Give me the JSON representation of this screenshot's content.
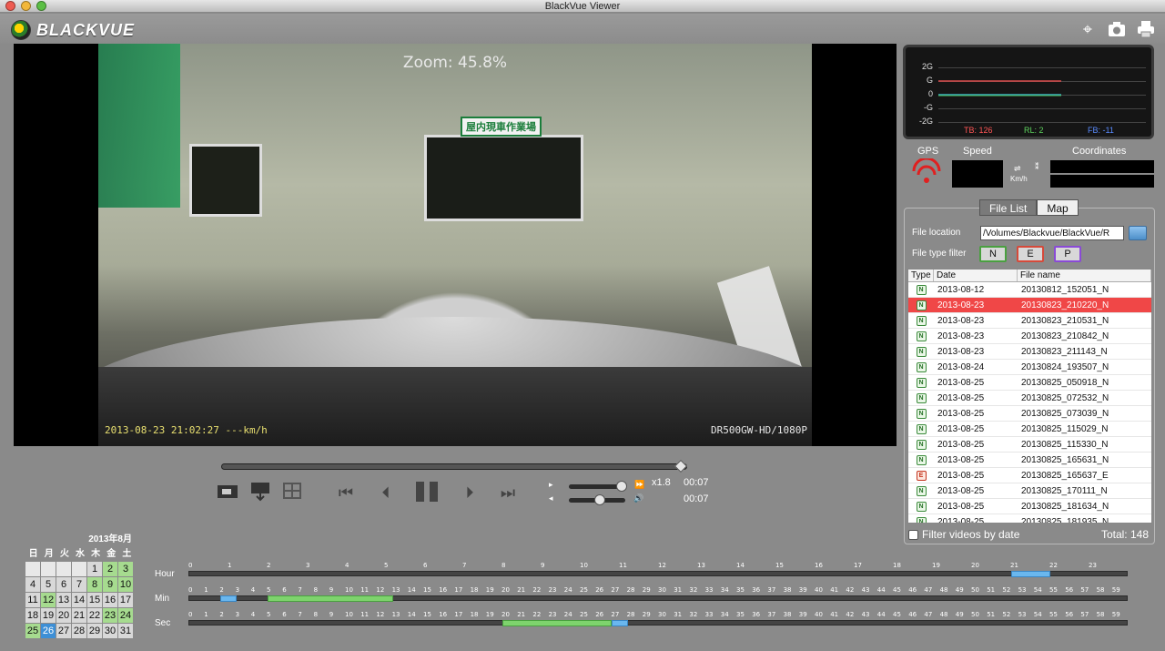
{
  "window": {
    "title": "BlackVue Viewer"
  },
  "brand": {
    "name": "BLACKVUE"
  },
  "toolbar_icons": [
    "crosshair-icon",
    "camera-icon",
    "printer-icon"
  ],
  "video": {
    "zoom_text": "Zoom: 45.8%",
    "timestamp": "2013-08-23 21:02:27  ---km/h",
    "model": "DR500GW-HD/1080P",
    "sign_text": "屋内現車作業場"
  },
  "playback": {
    "progress": 0.99,
    "speed_label": "x1.8",
    "time_top": "00:07",
    "time_bottom": "00:07"
  },
  "gsensor": {
    "labels": [
      "2G",
      "G",
      "0",
      "-G",
      "-2G"
    ],
    "tb": "TB: 126",
    "rl": "RL: 2",
    "fb": "FB: -11"
  },
  "gps": {
    "gps_label": "GPS",
    "speed_label": "Speed",
    "unit": "Km/h",
    "coords_label": "Coordinates"
  },
  "tabs": {
    "file_list": "File List",
    "map": "Map"
  },
  "filelist": {
    "location_label": "File location",
    "location_value": "/Volumes/Blackvue/BlackVue/R",
    "filter_label": "File type filter",
    "filters": [
      "N",
      "E",
      "P"
    ],
    "columns": [
      "Type",
      "Date",
      "File name"
    ],
    "rows": [
      {
        "type": "N",
        "date": "2013-08-12",
        "file": "20130812_152051_N"
      },
      {
        "type": "N",
        "date": "2013-08-23",
        "file": "20130823_210220_N",
        "selected": true
      },
      {
        "type": "N",
        "date": "2013-08-23",
        "file": "20130823_210531_N"
      },
      {
        "type": "N",
        "date": "2013-08-23",
        "file": "20130823_210842_N"
      },
      {
        "type": "N",
        "date": "2013-08-23",
        "file": "20130823_211143_N"
      },
      {
        "type": "N",
        "date": "2013-08-24",
        "file": "20130824_193507_N"
      },
      {
        "type": "N",
        "date": "2013-08-25",
        "file": "20130825_050918_N"
      },
      {
        "type": "N",
        "date": "2013-08-25",
        "file": "20130825_072532_N"
      },
      {
        "type": "N",
        "date": "2013-08-25",
        "file": "20130825_073039_N"
      },
      {
        "type": "N",
        "date": "2013-08-25",
        "file": "20130825_115029_N"
      },
      {
        "type": "N",
        "date": "2013-08-25",
        "file": "20130825_115330_N"
      },
      {
        "type": "N",
        "date": "2013-08-25",
        "file": "20130825_165631_N"
      },
      {
        "type": "E",
        "date": "2013-08-25",
        "file": "20130825_165637_E"
      },
      {
        "type": "N",
        "date": "2013-08-25",
        "file": "20130825_170111_N"
      },
      {
        "type": "N",
        "date": "2013-08-25",
        "file": "20130825_181634_N"
      },
      {
        "type": "N",
        "date": "2013-08-25",
        "file": "20130825_181935_N"
      }
    ],
    "filter_by_date": "Filter videos by date",
    "total": "Total: 148"
  },
  "calendar": {
    "title": "2013年8月",
    "weekdays": [
      "日",
      "月",
      "火",
      "水",
      "木",
      "金",
      "土"
    ],
    "leading_blanks": 4,
    "days": 31,
    "recorded": [
      2,
      3,
      8,
      9,
      10,
      12,
      23,
      24,
      25
    ],
    "current": 26
  },
  "timeline": {
    "hour_label": "Hour",
    "min_label": "Min",
    "sec_label": "Sec",
    "hour_segments": [
      {
        "start": 21,
        "end": 22,
        "blue": true
      }
    ],
    "min_segments": [
      {
        "start": 2,
        "end": 3,
        "blue": true
      },
      {
        "start": 5,
        "end": 13,
        "blue": false
      }
    ],
    "sec_segments": [
      {
        "start": 20,
        "end": 27,
        "blue": false
      },
      {
        "start": 27,
        "end": 28,
        "blue": true
      }
    ]
  },
  "colors": {
    "accent": "#f04747",
    "record": "#7ed36d",
    "current": "#3d8fd6"
  }
}
